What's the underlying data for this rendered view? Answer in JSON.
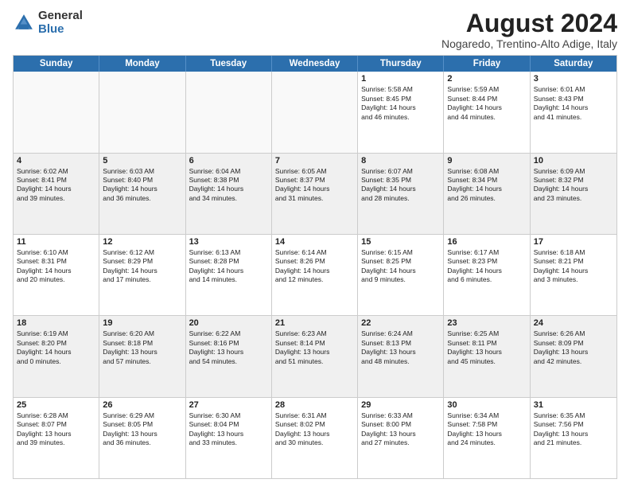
{
  "logo": {
    "general": "General",
    "blue": "Blue"
  },
  "title": "August 2024",
  "subtitle": "Nogaredo, Trentino-Alto Adige, Italy",
  "header_days": [
    "Sunday",
    "Monday",
    "Tuesday",
    "Wednesday",
    "Thursday",
    "Friday",
    "Saturday"
  ],
  "rows": [
    [
      {
        "day": "",
        "text": "",
        "empty": true
      },
      {
        "day": "",
        "text": "",
        "empty": true
      },
      {
        "day": "",
        "text": "",
        "empty": true
      },
      {
        "day": "",
        "text": "",
        "empty": true
      },
      {
        "day": "1",
        "text": "Sunrise: 5:58 AM\nSunset: 8:45 PM\nDaylight: 14 hours\nand 46 minutes.",
        "empty": false
      },
      {
        "day": "2",
        "text": "Sunrise: 5:59 AM\nSunset: 8:44 PM\nDaylight: 14 hours\nand 44 minutes.",
        "empty": false
      },
      {
        "day": "3",
        "text": "Sunrise: 6:01 AM\nSunset: 8:43 PM\nDaylight: 14 hours\nand 41 minutes.",
        "empty": false
      }
    ],
    [
      {
        "day": "4",
        "text": "Sunrise: 6:02 AM\nSunset: 8:41 PM\nDaylight: 14 hours\nand 39 minutes.",
        "empty": false
      },
      {
        "day": "5",
        "text": "Sunrise: 6:03 AM\nSunset: 8:40 PM\nDaylight: 14 hours\nand 36 minutes.",
        "empty": false
      },
      {
        "day": "6",
        "text": "Sunrise: 6:04 AM\nSunset: 8:38 PM\nDaylight: 14 hours\nand 34 minutes.",
        "empty": false
      },
      {
        "day": "7",
        "text": "Sunrise: 6:05 AM\nSunset: 8:37 PM\nDaylight: 14 hours\nand 31 minutes.",
        "empty": false
      },
      {
        "day": "8",
        "text": "Sunrise: 6:07 AM\nSunset: 8:35 PM\nDaylight: 14 hours\nand 28 minutes.",
        "empty": false
      },
      {
        "day": "9",
        "text": "Sunrise: 6:08 AM\nSunset: 8:34 PM\nDaylight: 14 hours\nand 26 minutes.",
        "empty": false
      },
      {
        "day": "10",
        "text": "Sunrise: 6:09 AM\nSunset: 8:32 PM\nDaylight: 14 hours\nand 23 minutes.",
        "empty": false
      }
    ],
    [
      {
        "day": "11",
        "text": "Sunrise: 6:10 AM\nSunset: 8:31 PM\nDaylight: 14 hours\nand 20 minutes.",
        "empty": false
      },
      {
        "day": "12",
        "text": "Sunrise: 6:12 AM\nSunset: 8:29 PM\nDaylight: 14 hours\nand 17 minutes.",
        "empty": false
      },
      {
        "day": "13",
        "text": "Sunrise: 6:13 AM\nSunset: 8:28 PM\nDaylight: 14 hours\nand 14 minutes.",
        "empty": false
      },
      {
        "day": "14",
        "text": "Sunrise: 6:14 AM\nSunset: 8:26 PM\nDaylight: 14 hours\nand 12 minutes.",
        "empty": false
      },
      {
        "day": "15",
        "text": "Sunrise: 6:15 AM\nSunset: 8:25 PM\nDaylight: 14 hours\nand 9 minutes.",
        "empty": false
      },
      {
        "day": "16",
        "text": "Sunrise: 6:17 AM\nSunset: 8:23 PM\nDaylight: 14 hours\nand 6 minutes.",
        "empty": false
      },
      {
        "day": "17",
        "text": "Sunrise: 6:18 AM\nSunset: 8:21 PM\nDaylight: 14 hours\nand 3 minutes.",
        "empty": false
      }
    ],
    [
      {
        "day": "18",
        "text": "Sunrise: 6:19 AM\nSunset: 8:20 PM\nDaylight: 14 hours\nand 0 minutes.",
        "empty": false
      },
      {
        "day": "19",
        "text": "Sunrise: 6:20 AM\nSunset: 8:18 PM\nDaylight: 13 hours\nand 57 minutes.",
        "empty": false
      },
      {
        "day": "20",
        "text": "Sunrise: 6:22 AM\nSunset: 8:16 PM\nDaylight: 13 hours\nand 54 minutes.",
        "empty": false
      },
      {
        "day": "21",
        "text": "Sunrise: 6:23 AM\nSunset: 8:14 PM\nDaylight: 13 hours\nand 51 minutes.",
        "empty": false
      },
      {
        "day": "22",
        "text": "Sunrise: 6:24 AM\nSunset: 8:13 PM\nDaylight: 13 hours\nand 48 minutes.",
        "empty": false
      },
      {
        "day": "23",
        "text": "Sunrise: 6:25 AM\nSunset: 8:11 PM\nDaylight: 13 hours\nand 45 minutes.",
        "empty": false
      },
      {
        "day": "24",
        "text": "Sunrise: 6:26 AM\nSunset: 8:09 PM\nDaylight: 13 hours\nand 42 minutes.",
        "empty": false
      }
    ],
    [
      {
        "day": "25",
        "text": "Sunrise: 6:28 AM\nSunset: 8:07 PM\nDaylight: 13 hours\nand 39 minutes.",
        "empty": false
      },
      {
        "day": "26",
        "text": "Sunrise: 6:29 AM\nSunset: 8:05 PM\nDaylight: 13 hours\nand 36 minutes.",
        "empty": false
      },
      {
        "day": "27",
        "text": "Sunrise: 6:30 AM\nSunset: 8:04 PM\nDaylight: 13 hours\nand 33 minutes.",
        "empty": false
      },
      {
        "day": "28",
        "text": "Sunrise: 6:31 AM\nSunset: 8:02 PM\nDaylight: 13 hours\nand 30 minutes.",
        "empty": false
      },
      {
        "day": "29",
        "text": "Sunrise: 6:33 AM\nSunset: 8:00 PM\nDaylight: 13 hours\nand 27 minutes.",
        "empty": false
      },
      {
        "day": "30",
        "text": "Sunrise: 6:34 AM\nSunset: 7:58 PM\nDaylight: 13 hours\nand 24 minutes.",
        "empty": false
      },
      {
        "day": "31",
        "text": "Sunrise: 6:35 AM\nSunset: 7:56 PM\nDaylight: 13 hours\nand 21 minutes.",
        "empty": false
      }
    ]
  ]
}
